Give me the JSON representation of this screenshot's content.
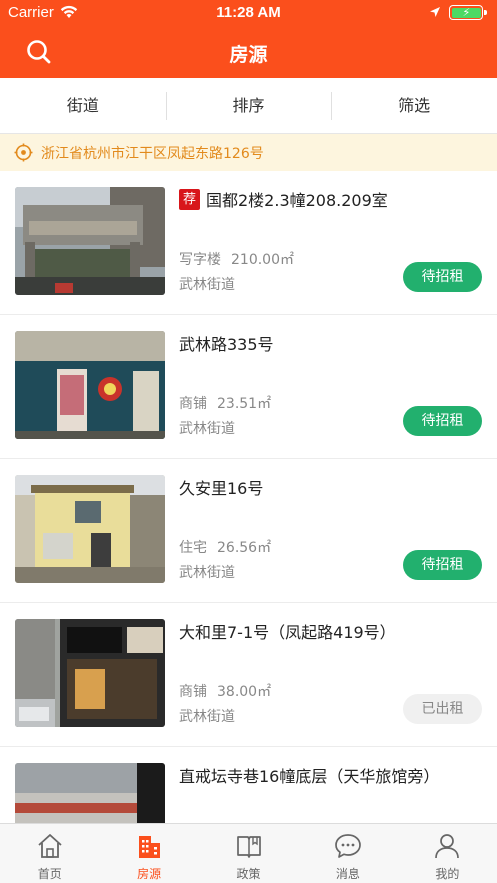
{
  "status_bar": {
    "carrier": "Carrier",
    "time": "11:28 AM",
    "battery_percent": 100,
    "battery_color": "#4cd964"
  },
  "nav": {
    "title": "房源",
    "search_icon": "search-icon",
    "background": "#fb4f1c"
  },
  "filters": [
    {
      "label": "街道"
    },
    {
      "label": "排序"
    },
    {
      "label": "筛选"
    }
  ],
  "location": {
    "address": "浙江省杭州市江干区凤起东路126号",
    "icon": "locate-icon"
  },
  "listings": [
    {
      "title": "国都2楼2.3幢208.209室",
      "recommended": true,
      "badge": "荐",
      "type": "写字楼",
      "area": "210.00㎡",
      "street": "武林街道",
      "status": "待招租",
      "status_kind": "open",
      "photo": "gate-photo"
    },
    {
      "title": "武林路335号",
      "recommended": false,
      "badge": "",
      "type": "商铺",
      "area": "23.51㎡",
      "street": "武林街道",
      "status": "待招租",
      "status_kind": "open",
      "photo": "shopfront-photo"
    },
    {
      "title": "久安里16号",
      "recommended": false,
      "badge": "",
      "type": "住宅",
      "area": "26.56㎡",
      "street": "武林街道",
      "status": "待招租",
      "status_kind": "open",
      "photo": "residence-photo"
    },
    {
      "title": "大和里7-1号（凤起路419号）",
      "recommended": false,
      "badge": "",
      "type": "商铺",
      "area": "38.00㎡",
      "street": "武林街道",
      "status": "已出租",
      "status_kind": "rented",
      "photo": "restaurant-photo"
    },
    {
      "title": "直戒坛寺巷16幢底层（天华旅馆旁）",
      "recommended": false,
      "badge": "",
      "type": "",
      "area": "",
      "street": "",
      "status": "",
      "status_kind": "",
      "photo": "street-photo"
    }
  ],
  "colors": {
    "accent": "#fb4f1c",
    "open_status": "#22b06e",
    "rented_status": "#f0f0f0",
    "recommend_badge": "#d8161b",
    "location_text": "#e28a1c"
  },
  "tabbar": [
    {
      "label": "首页",
      "icon": "home-icon",
      "active": false
    },
    {
      "label": "房源",
      "icon": "building-icon",
      "active": true
    },
    {
      "label": "政策",
      "icon": "book-icon",
      "active": false
    },
    {
      "label": "消息",
      "icon": "chat-icon",
      "active": false
    },
    {
      "label": "我的",
      "icon": "person-icon",
      "active": false
    }
  ]
}
